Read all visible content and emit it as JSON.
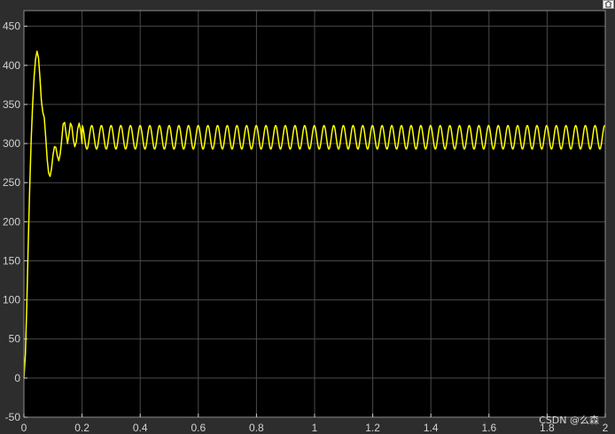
{
  "chart_data": {
    "type": "line",
    "title": "",
    "xlabel": "",
    "ylabel": "",
    "xlim": [
      0,
      2
    ],
    "ylim": [
      -50,
      470
    ],
    "grid": true,
    "x_ticks": [
      0,
      0.2,
      0.4,
      0.6,
      0.8,
      1,
      1.2,
      1.4,
      1.6,
      1.8,
      2
    ],
    "x_tick_labels": [
      "0",
      "0.2",
      "0.4",
      "0.6",
      "0.8",
      "1",
      "1.2",
      "1.4",
      "1.6",
      "1.8",
      "2"
    ],
    "y_ticks": [
      -50,
      0,
      50,
      100,
      150,
      200,
      250,
      300,
      350,
      400,
      450
    ],
    "y_tick_labels": [
      "-50",
      "0",
      "50",
      "100",
      "150",
      "200",
      "250",
      "300",
      "350",
      "400",
      "450"
    ],
    "series": [
      {
        "color": "#ffff00",
        "transient": {
          "x": [
            0,
            0.005,
            0.01,
            0.015,
            0.02,
            0.025,
            0.03,
            0.035,
            0.04,
            0.045,
            0.05,
            0.055,
            0.06,
            0.065,
            0.07,
            0.075,
            0.08,
            0.085,
            0.09,
            0.095,
            0.1,
            0.105,
            0.11,
            0.115,
            0.12,
            0.125,
            0.13,
            0.135,
            0.14,
            0.145,
            0.15,
            0.155,
            0.16,
            0.165,
            0.17,
            0.175,
            0.18,
            0.185,
            0.19,
            0.195,
            0.2
          ],
          "y": [
            0,
            30,
            95,
            175,
            245,
            305,
            350,
            385,
            408,
            418,
            410,
            385,
            355,
            340,
            333,
            308,
            280,
            262,
            258,
            268,
            285,
            296,
            295,
            284,
            278,
            287,
            305,
            325,
            327,
            313,
            300,
            312,
            326,
            322,
            305,
            296,
            302,
            319,
            326,
            318,
            300
          ]
        },
        "steady_state": {
          "x_start": 0.2,
          "x_end": 2,
          "mean": 308,
          "amplitude": 15,
          "period": 0.0333
        }
      }
    ]
  },
  "watermark": "CSDN @么森",
  "icons": {
    "corner": "restore-icon"
  }
}
